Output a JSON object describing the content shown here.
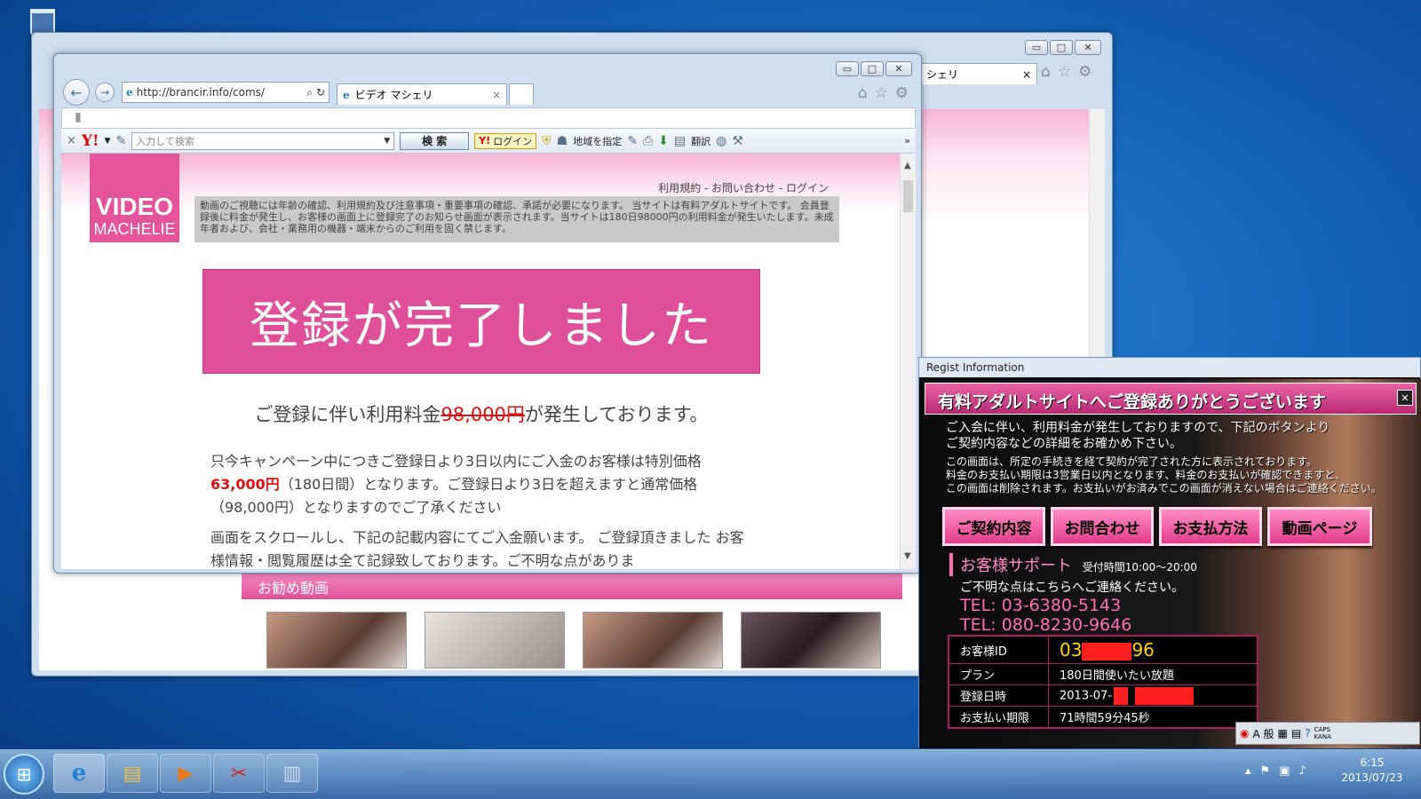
{
  "back_window": {
    "tab_label": "シェリ",
    "tab_close": "×"
  },
  "browser": {
    "url": "http://brancir.info/coms/",
    "search_glyph": "⌕",
    "tab_title": "ビデオ マシェリ",
    "tab_close": "×",
    "caption": {
      "min": "▭",
      "max": "□",
      "close": "✕"
    },
    "toolbar": {
      "close_glyph": "×",
      "yahoo_logo": "Y!",
      "search_placeholder": "入力して検索",
      "search_button": "検 索",
      "login_button": "ログイン",
      "region_button": "地域を指定",
      "translate_button": "翻訳",
      "more": "»"
    }
  },
  "site": {
    "logo_line1": "VIDEO",
    "logo_line2": "MACHELIE",
    "top_links": "利用規約 - お問い合わせ - ログイン",
    "notice": "動画のご視聴には年齢の確認、利用規約及び注意事項・重要事項の確認、承諾が必要になります。 当サイトは有料アダルトサイトです。 会員登録後に料金が発生し、お客様の画面上に登録完了のお知らせ画面が表示されます。当サイトは180日98000円の利用料金が発生いたします。未成年者および、会社・業務用の機器・端末からのご利用を固く禁じます。",
    "hero": "登録が完了しました",
    "fee_prefix": "ご登録に伴い利用料金",
    "fee_amount": "98,000円",
    "fee_suffix": "が発生しております。",
    "campaign_1": "只今キャンペーン中につきご登録日より3日以内にご入金のお客様は特別価格",
    "campaign_price": "63,000円",
    "campaign_2": "（180日間）となります。ご登録日より3日を超えますと通常価格（98,000円）となりますのでご了承ください",
    "scroll_text": "画面をスクロールし、下記の記載内容にてご入金願います。 ご登録頂きました お客様情報・閲覧履歴は全て記録致しております。ご不明な点がありま",
    "recommended": "お勧め動画"
  },
  "popup": {
    "window_title": "Regist Information",
    "headline": "有料アダルトサイトへご登録ありがとうございます",
    "close": "✕",
    "intro_1": "ご入会に伴い、利用料金が発生しておりますので、下記のボタンより",
    "intro_2": "ご契約内容などの詳細をお確かめ下さい。",
    "note_1": "この画面は、所定の手続きを経て契約が完了された方に表示されております。",
    "note_2": "料金のお支払い期限は3営業日以内となります、料金のお支払いが確認できますと、",
    "note_3": "この画面は削除されます。お支払いがお済みでこの画面が消えない場合はご連絡ください。",
    "buttons": [
      "ご契約内容",
      "お問合わせ",
      "お支払方法",
      "動画ページ"
    ],
    "support_title": "お客様サポート",
    "support_hours": "受付時間10:00～20:00",
    "support_note": "ご不明な点はこちらへご連絡ください。",
    "tel1": "TEL: 03-6380-5143",
    "tel2": "TEL: 080-8230-9646",
    "table": {
      "id_label": "お客様ID",
      "id_start": "03",
      "id_end": "96",
      "plan_label": "プラン",
      "plan_value": "180日間使いたい放題",
      "date_label": "登録日時",
      "date_value": "2013-07-",
      "deadline_label": "お支払い期限",
      "deadline_value": "71時間59分45秒"
    }
  },
  "taskbar": {
    "time": "6:15",
    "date": "2013/07/23",
    "ime": "A 般",
    "caps": "CAPS",
    "kana": "KANA"
  },
  "colors": {
    "pink": "#e0509a",
    "red": "#dd1111",
    "desktop": "#1563b8"
  }
}
